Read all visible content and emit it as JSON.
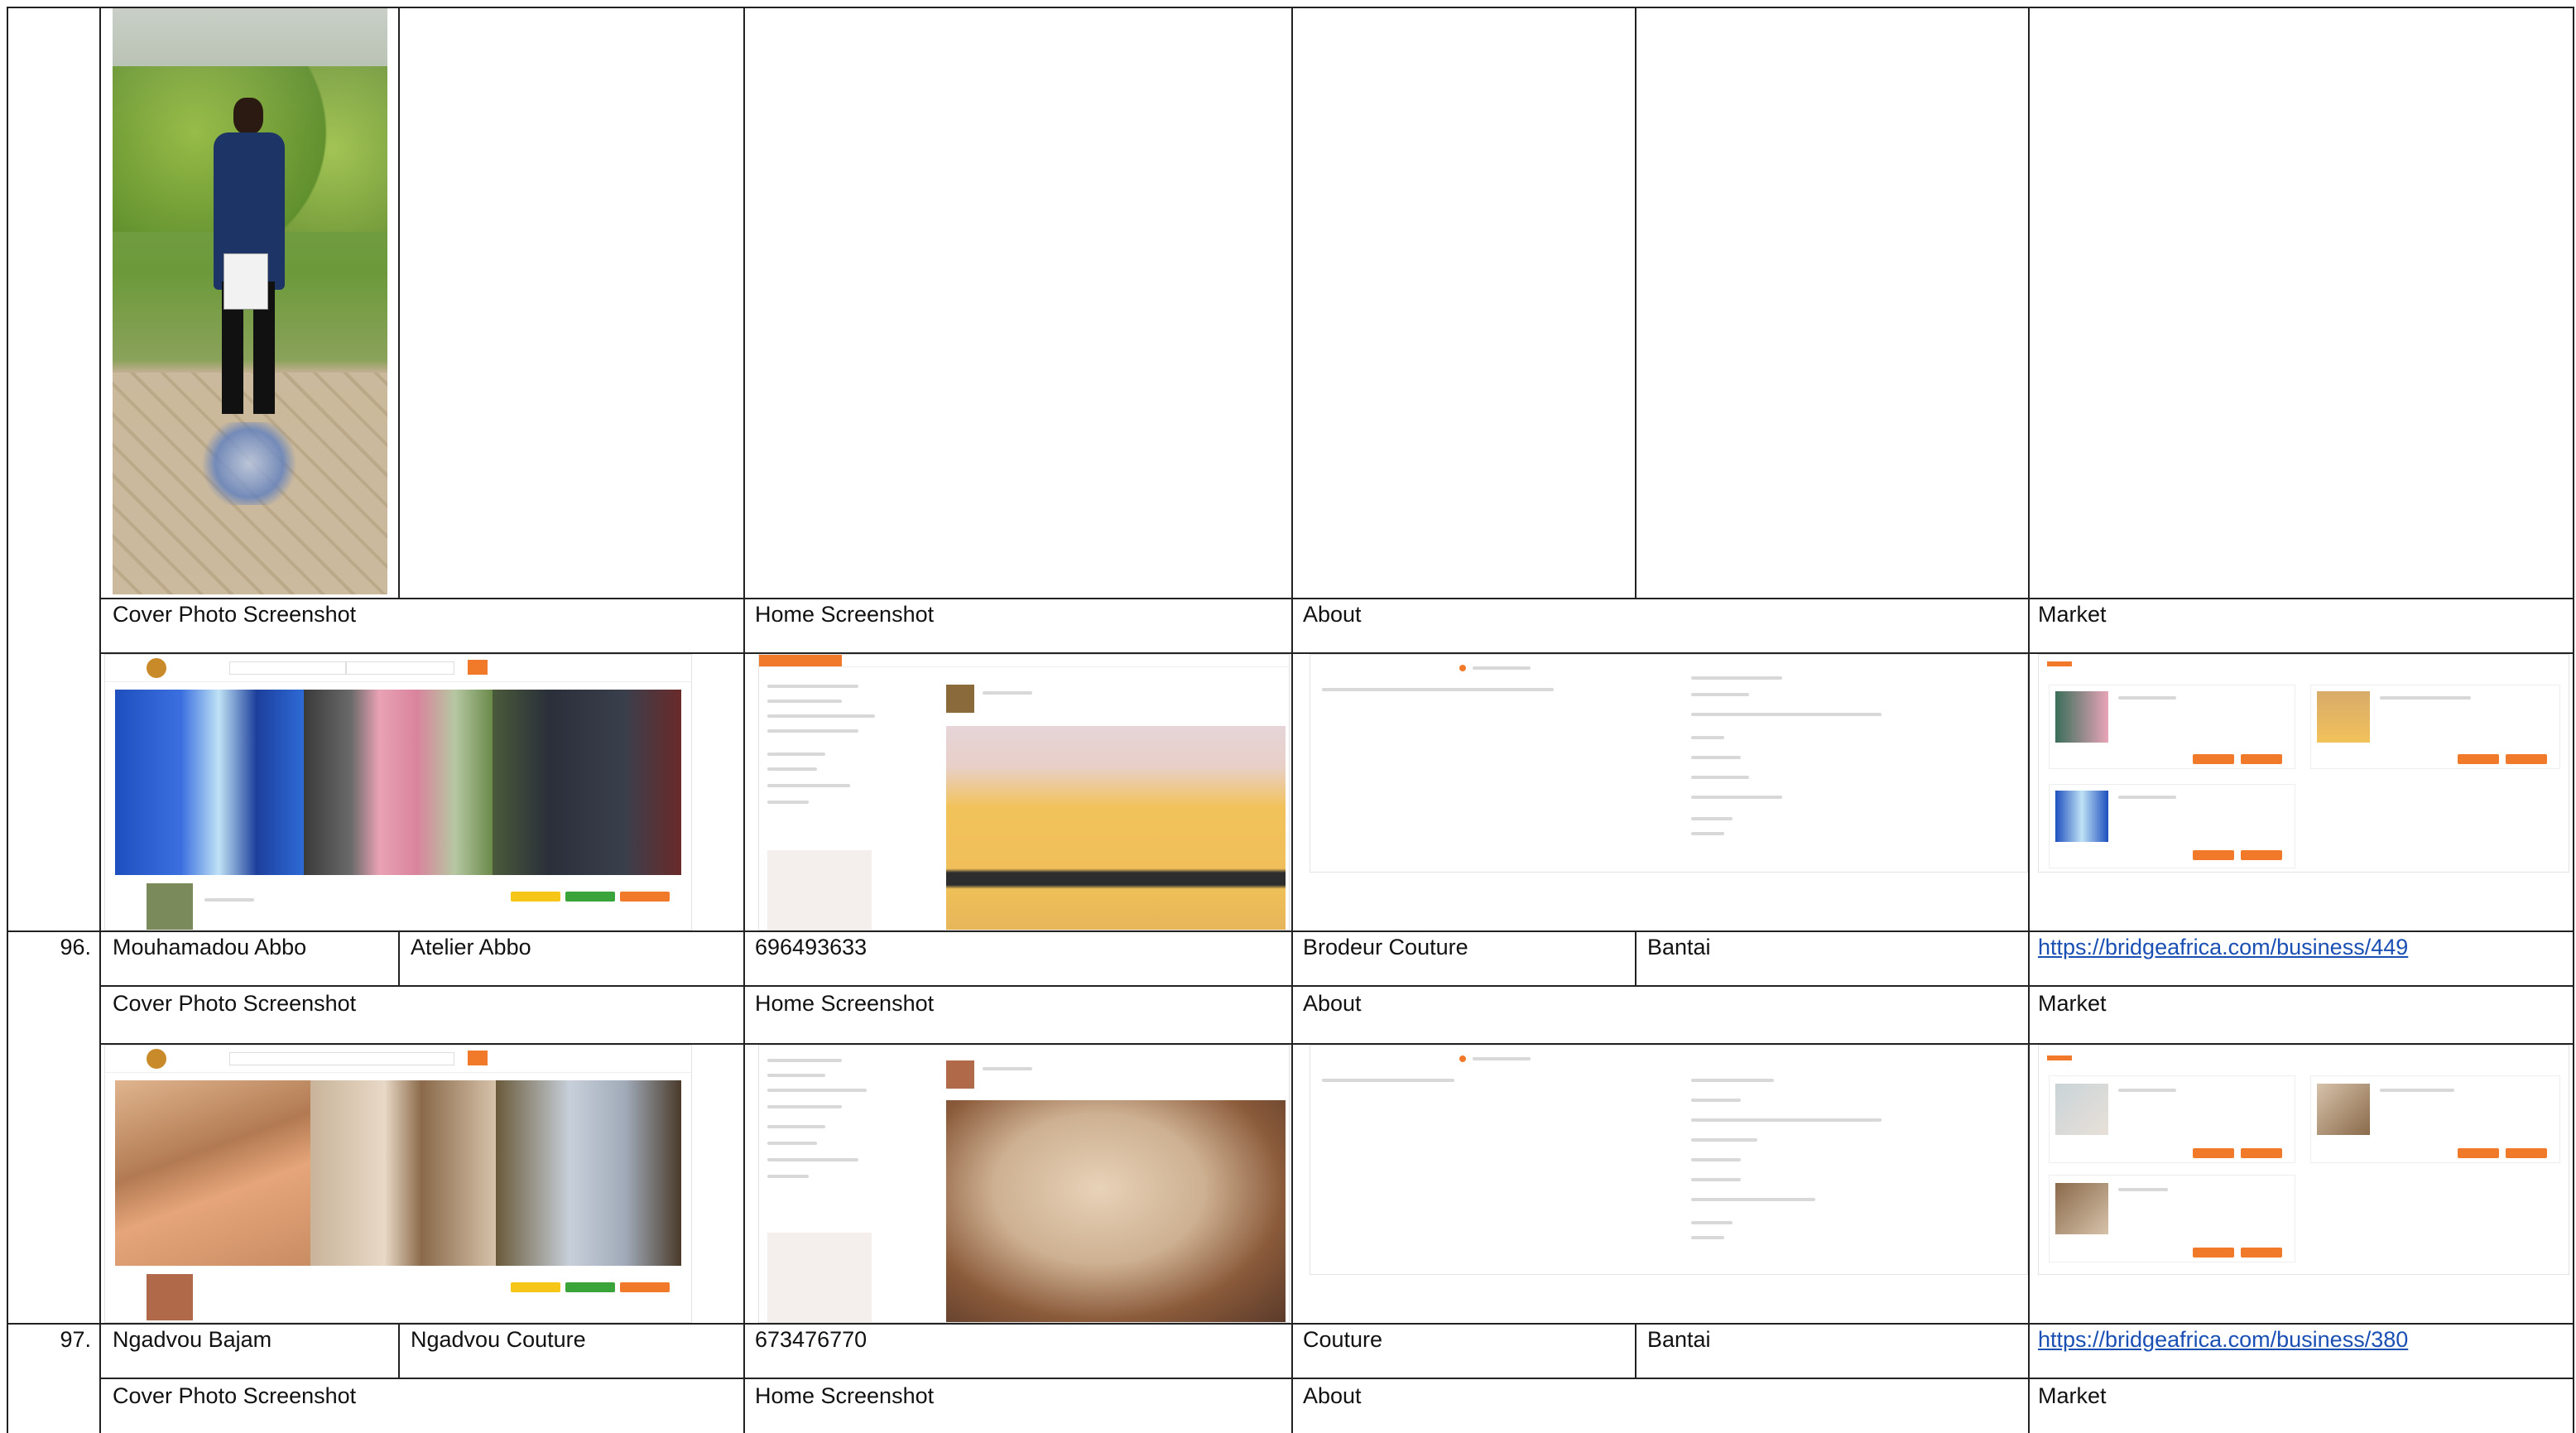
{
  "section_labels": {
    "cover": "Cover Photo Screenshot",
    "home": "Home Screenshot",
    "about": "About",
    "market": "Market"
  },
  "rows": [
    {
      "number": "96.",
      "owner": "Mouhamadou Abbo",
      "business": "Atelier Abbo",
      "phone": "696493633",
      "category": "Brodeur Couture",
      "location": "Bantai",
      "link": "https://bridgeafrica.com/business/449"
    },
    {
      "number": "97.",
      "owner": "Ngadvou Bajam",
      "business": "Ngadvou Couture",
      "phone": "673476770",
      "category": "Couture",
      "location": "Bantai",
      "link": "https://bridgeafrica.com/business/380"
    }
  ],
  "colors": {
    "accent": "#f07a2a",
    "link": "#1a4fb3",
    "border": "#222222"
  }
}
